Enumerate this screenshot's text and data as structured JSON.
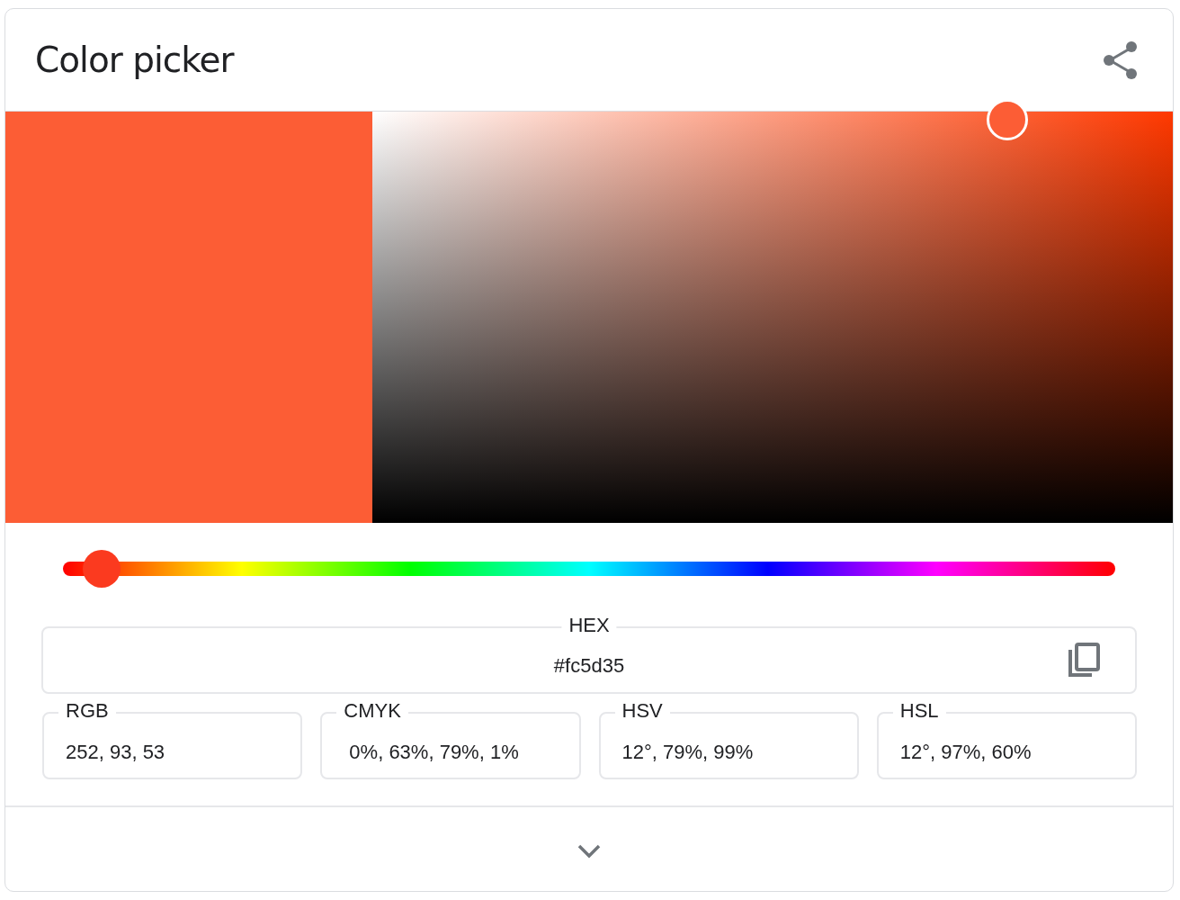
{
  "title": "Color picker",
  "swatch": {
    "color": "#fc5d35"
  },
  "hue_slider": {
    "level": 0.037
  },
  "hex": {
    "label": "HEX",
    "value": "#fc5d35"
  },
  "formats": [
    {
      "label": "RGB",
      "value": "252, 93, 53"
    },
    {
      "label": "CMYK",
      "value": " 0%, 63%, 79%, 1%"
    },
    {
      "label": "HSV",
      "value": "12°, 79%, 99%"
    },
    {
      "label": "HSL",
      "value": "12°, 97%, 60%"
    }
  ]
}
